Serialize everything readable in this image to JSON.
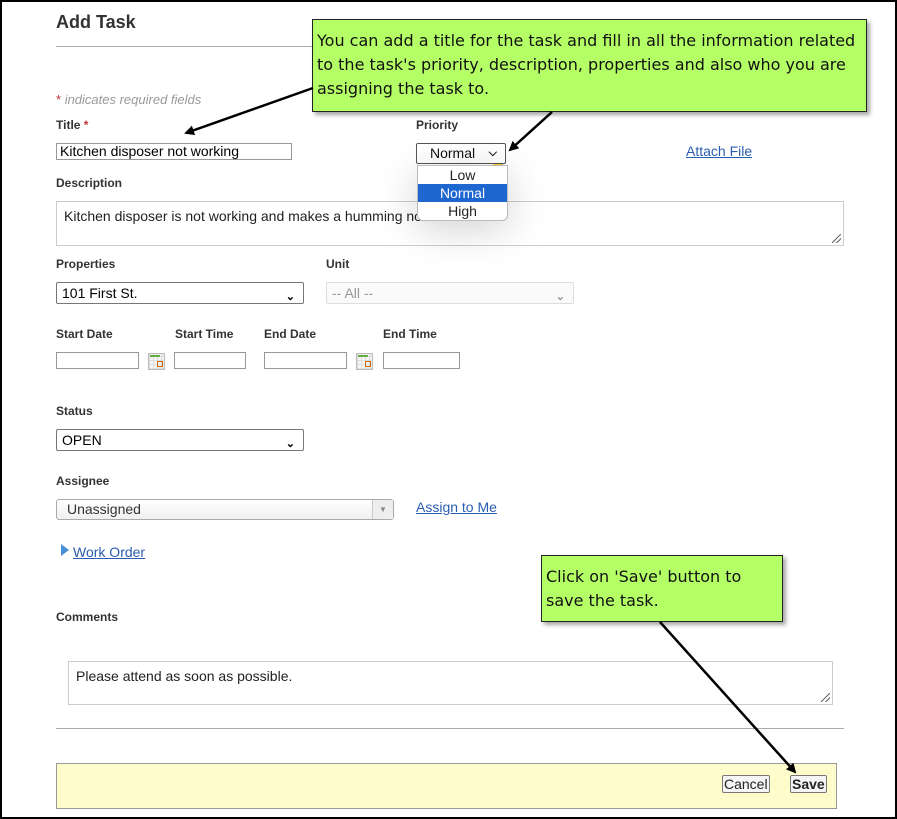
{
  "page": {
    "title": "Add Task",
    "required_note": "indicates required fields",
    "required_marker": "*"
  },
  "form": {
    "title": {
      "label": "Title",
      "value": "Kitchen disposer not working"
    },
    "priority": {
      "label": "Priority",
      "value": "Normal",
      "options": [
        "Low",
        "Normal",
        "High"
      ],
      "selected": "Normal"
    },
    "attach_file": "Attach File",
    "description": {
      "label": "Description",
      "value": "Kitchen disposer is not working and makes a humming noise."
    },
    "properties": {
      "label": "Properties",
      "value": "101 First St."
    },
    "unit": {
      "label": "Unit",
      "value": "-- All --"
    },
    "start_date": {
      "label": "Start Date",
      "value": ""
    },
    "start_time": {
      "label": "Start Time",
      "value": ""
    },
    "end_date": {
      "label": "End Date",
      "value": ""
    },
    "end_time": {
      "label": "End Time",
      "value": ""
    },
    "status": {
      "label": "Status",
      "value": "OPEN"
    },
    "assignee": {
      "label": "Assignee",
      "value": "Unassigned"
    },
    "assign_to_me": "Assign to Me",
    "work_order": "Work Order",
    "comments": {
      "label": "Comments",
      "value": "Please attend as soon as possible."
    }
  },
  "footer": {
    "cancel": "Cancel",
    "save": "Save"
  },
  "callouts": {
    "top": "You can add a title for the task and fill in all the information related to the task's priority, description, properties and also who you are assigning the task to.",
    "bottom": "Click on 'Save' button to save the task."
  },
  "colors": {
    "callout_bg": "#b5ff66",
    "link": "#2a5db0",
    "selected_option": "#1e66d0",
    "footer_bg": "#fffccc"
  }
}
